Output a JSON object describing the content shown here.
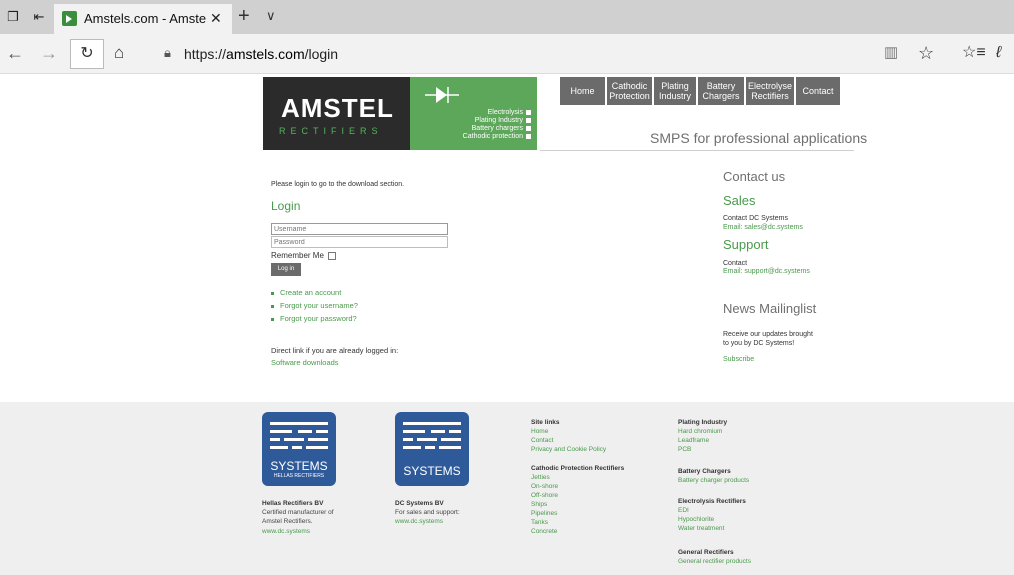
{
  "browser": {
    "tab_title": "Amstels.com - Amstel R",
    "url_prefix": "https://",
    "url_domain": "amstels.com",
    "url_path": "/login"
  },
  "header": {
    "logo_main": "AMSTEL",
    "logo_sub": "RECTIFIERS",
    "green_items": [
      "Electrolysis",
      "Plating Industry",
      "Battery chargers",
      "Cathodic protection"
    ],
    "nav": [
      {
        "line1": "Home",
        "line2": ""
      },
      {
        "line1": "Cathodic",
        "line2": "Protection"
      },
      {
        "line1": "Plating",
        "line2": "Industry"
      },
      {
        "line1": "Battery",
        "line2": "Chargers"
      },
      {
        "line1": "Electrolyse",
        "line2": "Rectifiers"
      },
      {
        "line1": "Contact",
        "line2": ""
      }
    ],
    "tagline": "SMPS for professional applications"
  },
  "login": {
    "intro": "Please login to go to the download section.",
    "title": "Login",
    "username_placeholder": "Username",
    "password_placeholder": "Password",
    "remember_label": "Remember Me",
    "button_label": "Log in",
    "links": [
      "Create an account",
      "Forgot your username?",
      "Forgot your password?"
    ],
    "direct_text": "Direct link if you are already logged in:",
    "software_link": "Software downloads"
  },
  "sidebar": {
    "contact_heading": "Contact us",
    "sales_heading": "Sales",
    "sales_line1": "Contact DC Systems",
    "sales_email": "Email: sales@dc.systems",
    "support_heading": "Support",
    "support_line1": "Contact",
    "support_email": "Email: support@dc.systems",
    "news_heading": "News Mailinglist",
    "news_line1": "Receive our updates brought",
    "news_line2": "to you by DC Systems!",
    "subscribe": "Subscribe"
  },
  "footer": {
    "logo1_text": "SYSTEMS",
    "logo1_sub": "HELLAS RECTIFIERS",
    "logo2_text": "SYSTEMS",
    "hellas": {
      "title": "Hellas Rectifiers BV",
      "line1": "Certified manufacturer of",
      "line2": "Amstel Rectifiers.",
      "link": "www.dc.systems"
    },
    "dcsys": {
      "title": "DC Systems BV",
      "line1": "For sales and support:",
      "link": "www.dc.systems"
    },
    "site_links": {
      "title": "Site links",
      "items": [
        "Home",
        "Contact",
        "Privacy and Cookie Policy"
      ]
    },
    "cathodic": {
      "title": "Cathodic Protection Rectifiers",
      "items": [
        "Jetties",
        "On-shore",
        "Off-shore",
        "Ships",
        "Pipelines",
        "Tanks",
        "Concrete"
      ]
    },
    "plating": {
      "title": "Plating Industry",
      "items": [
        "Hard chromium",
        "Leadframe",
        "PCB"
      ]
    },
    "battery": {
      "title": "Battery Chargers",
      "items": [
        "Battery charger products"
      ]
    },
    "electrolysis": {
      "title": "Electrolysis Rectifiers",
      "items": [
        "EDI",
        "Hypochlorite",
        "Water treatment"
      ]
    },
    "general": {
      "title": "General Rectifiers",
      "items": [
        "General rectifier products"
      ]
    }
  },
  "colors": {
    "brand_green": "#4a9a4c",
    "nav_gray": "#6b6b6b",
    "dcsys_blue": "#2f5a9a"
  }
}
